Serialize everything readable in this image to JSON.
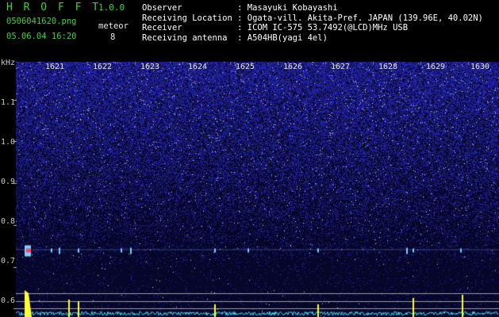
{
  "header": {
    "app_title": "H R O F F T",
    "version": "1.0.0",
    "filename": "0506041620.png",
    "datetime": "05.06.04 16:20",
    "meteor_label": "meteor",
    "meteor_count": "8"
  },
  "info": {
    "observer": "Observer           : Masayuki Kobayashi",
    "location": "Receiving Location : Ogata-vill. Akita-Pref. JAPAN (139.96E, 40.02N)",
    "receiver": "Receiver           : ICOM IC-575 53.7492(@LCD)MHz USB",
    "antenna": "Receiving antenna  : A504HB(yagi 4el)"
  },
  "spectrogram": {
    "y_unit": "kHz",
    "y_ticks": [
      "1.1",
      "1.0",
      "0.9",
      "0.8",
      "0.7",
      "0.6"
    ],
    "y_tick_values": [
      1.1,
      1.0,
      0.9,
      0.8,
      0.7,
      0.6
    ],
    "y_range": [
      0.58,
      1.19
    ],
    "time_labels": [
      "1621",
      "1622",
      "1623",
      "1624",
      "1625",
      "1626",
      "1627",
      "1628",
      "1629",
      "1630"
    ],
    "meteor_times_min": [
      0.9,
      2.4,
      8.2
    ],
    "colors": {
      "background": "#06062a",
      "noise": "#2a2aa8",
      "meteor_head": "#ff3b6a",
      "meteor_trail": "#7ad0ff",
      "yellow_trace": "#ffff33",
      "cyan_trace": "#40e0f0",
      "grid": "#9a9a9a"
    }
  }
}
